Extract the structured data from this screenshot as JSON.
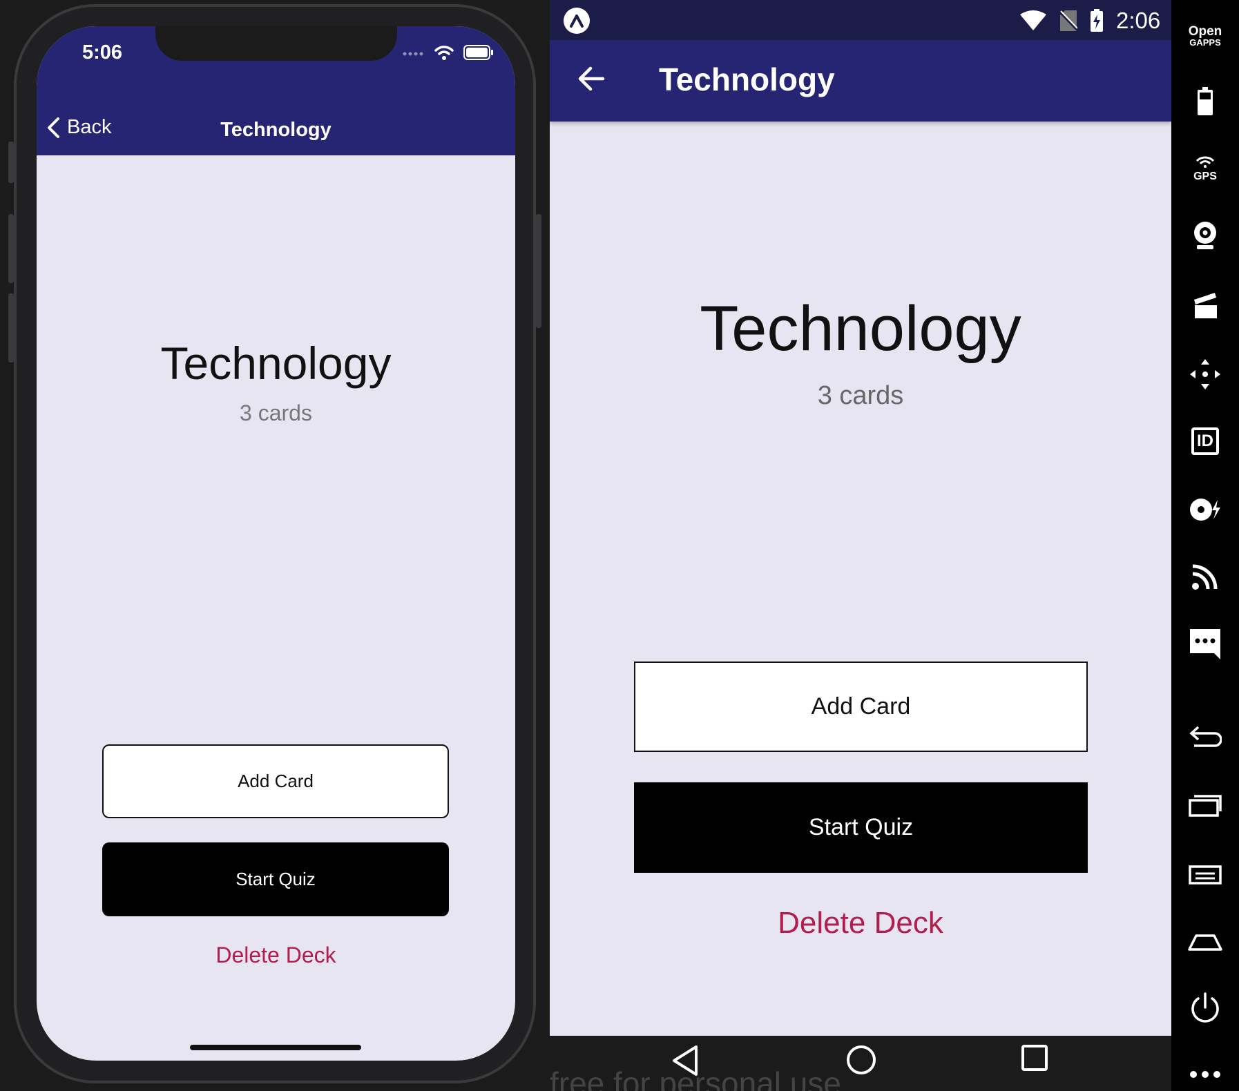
{
  "ios": {
    "status_time": "5:06",
    "nav_back_label": "Back",
    "nav_title": "Technology",
    "deck_title": "Technology",
    "card_count": "3 cards",
    "add_card_label": "Add Card",
    "start_quiz_label": "Start Quiz",
    "delete_deck_label": "Delete Deck"
  },
  "android": {
    "status_time": "2:06",
    "toolbar_title": "Technology",
    "deck_title": "Technology",
    "card_count": "3 cards",
    "add_card_label": "Add Card",
    "start_quiz_label": "Start Quiz",
    "delete_deck_label": "Delete Deck",
    "watermark": "free for personal use"
  },
  "emulator_sidebar": {
    "gapps_line1": "Open",
    "gapps_line2": "GAPPS",
    "gps_label": "GPS",
    "id_label": "ID",
    "icons": [
      "open-gapps-icon",
      "battery-icon",
      "gps-icon",
      "camera-icon",
      "media-icon",
      "move-icon",
      "id-icon",
      "disk-icon",
      "cast-icon",
      "message-icon",
      "back-icon",
      "recent-apps-icon",
      "menu-icon",
      "home-icon",
      "power-icon",
      "more-icon"
    ]
  },
  "colors": {
    "header": "#262573",
    "android_status": "#1c1c48",
    "screen_bg": "#e8e5f2",
    "delete": "#b21d4c"
  }
}
